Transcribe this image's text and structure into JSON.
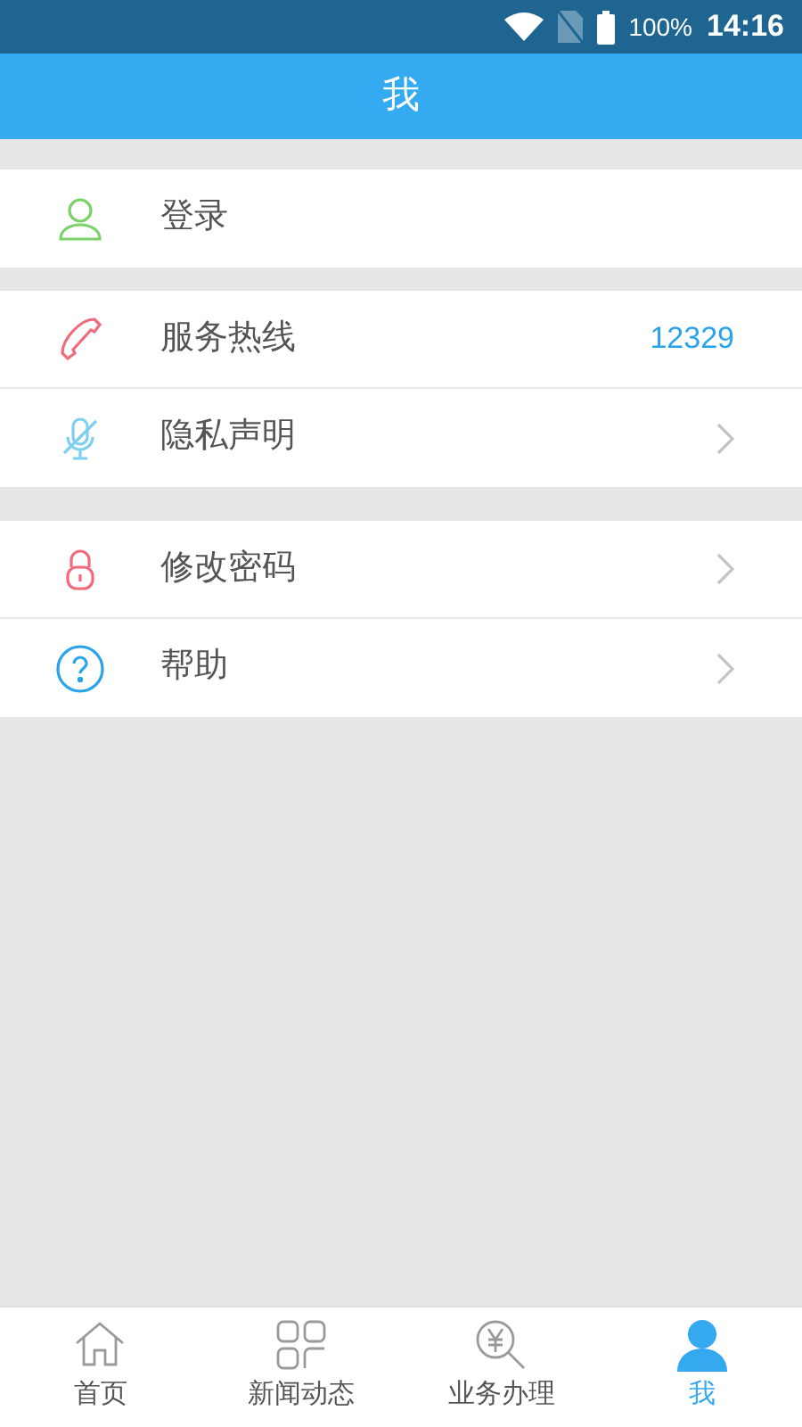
{
  "status_bar": {
    "battery": "100%",
    "time": "14:16"
  },
  "header": {
    "title": "我"
  },
  "sections": [
    {
      "items": [
        {
          "label": "登录",
          "kind": "plain"
        }
      ]
    },
    {
      "items": [
        {
          "label": "服务热线",
          "kind": "value",
          "value": "12329"
        },
        {
          "label": "隐私声明",
          "kind": "link"
        }
      ]
    },
    {
      "items": [
        {
          "label": "修改密码",
          "kind": "link"
        },
        {
          "label": "帮助",
          "kind": "link"
        }
      ]
    }
  ],
  "tabs": [
    {
      "label": "首页",
      "selected": false
    },
    {
      "label": "新闻动态",
      "selected": false
    },
    {
      "label": "业务办理",
      "selected": false
    },
    {
      "label": "我",
      "selected": true
    }
  ]
}
